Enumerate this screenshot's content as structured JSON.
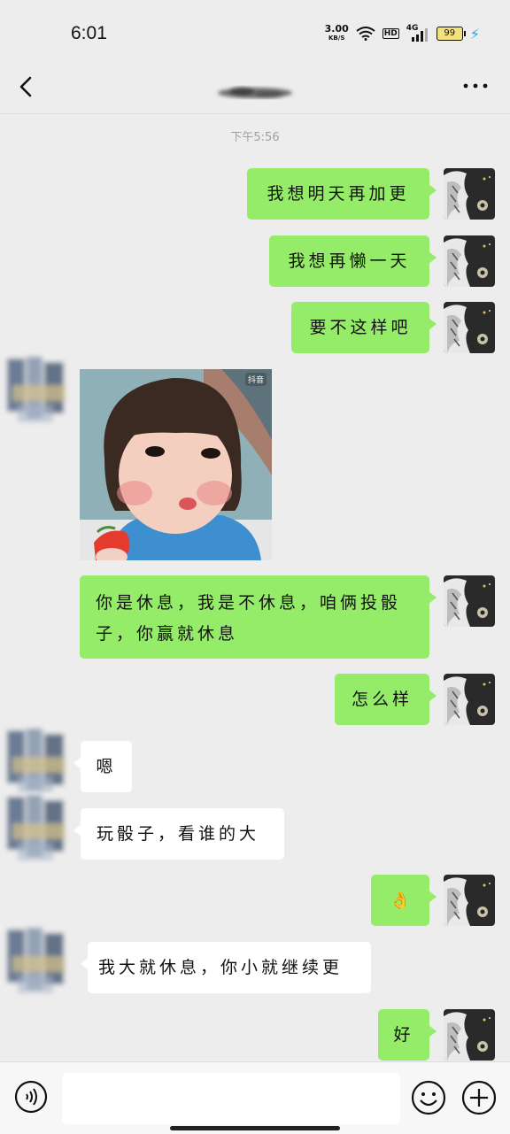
{
  "status": {
    "time": "6:01",
    "net_speed": "3.00",
    "net_unit": "KB/S",
    "hd": "HD",
    "network": "4G",
    "battery": "99"
  },
  "chat": {
    "timestamp": "下午5:56",
    "messages": [
      {
        "side": "out",
        "text": "我想明天再加更"
      },
      {
        "side": "out",
        "text": "我想再懒一天"
      },
      {
        "side": "out",
        "text": "要不这样吧"
      },
      {
        "side": "in",
        "type": "sticker",
        "sticker_label": "抖音"
      },
      {
        "side": "out",
        "text": "你是休息，我是不休息，咱俩投骰子，你赢就休息"
      },
      {
        "side": "out",
        "text": "怎么样"
      },
      {
        "side": "in",
        "text": "嗯"
      },
      {
        "side": "in",
        "text": "玩骰子，看谁的大"
      },
      {
        "side": "out",
        "text": "👌"
      },
      {
        "side": "in",
        "text": "我大就休息，你小就继续更"
      },
      {
        "side": "out",
        "text": "好"
      }
    ]
  },
  "icons": {
    "back": "back-arrow-icon",
    "more": "more-dots-icon",
    "voice": "voice-icon",
    "emoji": "emoji-icon",
    "plus": "plus-icon"
  },
  "colors": {
    "out_bubble": "#95ec69",
    "in_bubble": "#ffffff",
    "background": "#ededed"
  }
}
